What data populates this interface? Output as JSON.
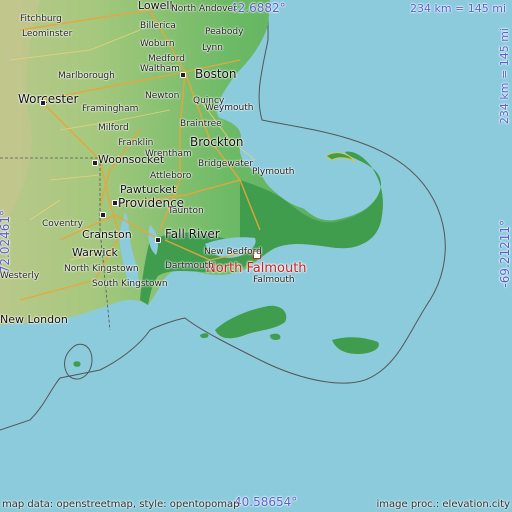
{
  "map": {
    "highlight_label": "North Falmouth",
    "coords": {
      "top_lat": "42.6882°",
      "bottom_lat": "40.58654°",
      "left_lon": "-72.02461°",
      "right_lon": "-69.21211°"
    },
    "scale_top": "234 km = 145 mi",
    "scale_right": "234 km = 145 mi",
    "credit_left": "map data: openstreetmap, style: opentopomap",
    "credit_right": "image proc.: elevation.city",
    "places": [
      "Fitchburg",
      "Lowell",
      "North Andover",
      "Leominster",
      "Billerica",
      "Peabody",
      "Woburn",
      "Lynn",
      "Medford",
      "Marlborough",
      "Boston",
      "Waltham",
      "Worcester",
      "Newton",
      "Quincy",
      "Framingham",
      "Weymouth",
      "Milford",
      "Braintree",
      "Franklin",
      "Brockton",
      "Woonsocket",
      "Bridgewater",
      "Attleboro",
      "Pawtucket",
      "Plymouth",
      "Providence",
      "Coventry",
      "Cranston",
      "Fall River",
      "Warwick",
      "New Bedford",
      "North Kingstown",
      "Dartmouth",
      "South Kingstown",
      "New London",
      "Falmouth",
      "Westerly",
      "Taunton",
      "Wrentham"
    ]
  }
}
